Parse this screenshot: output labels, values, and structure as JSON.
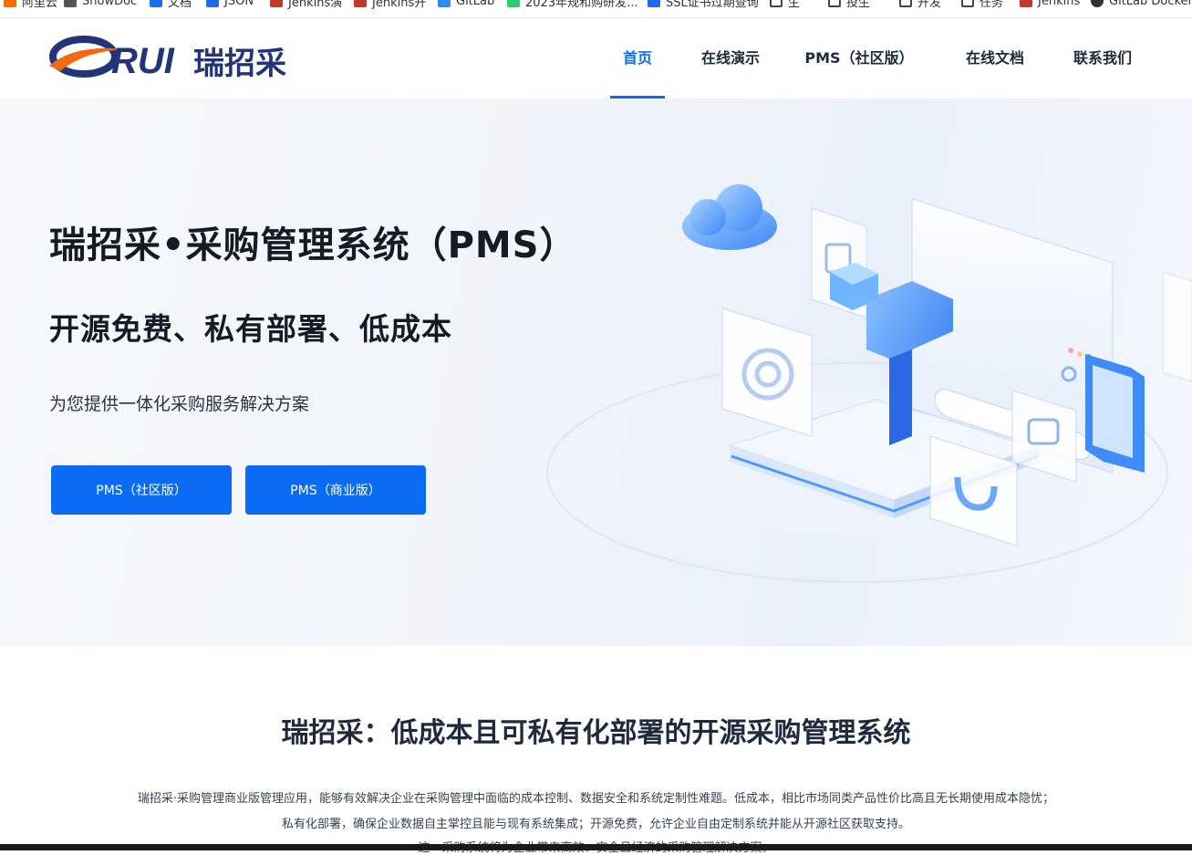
{
  "bookmarks": [
    {
      "label": "阿里云",
      "color": "#ff6a00"
    },
    {
      "label": "ShowDoc",
      "color": "#555555"
    },
    {
      "label": "文档",
      "color": "#1d6cf0"
    },
    {
      "label": "JSON",
      "color": "#1d6cf0"
    },
    {
      "label": "Jenkins演",
      "color": "#c0392b"
    },
    {
      "label": "Jenkins开",
      "color": "#c0392b"
    },
    {
      "label": "GitLab",
      "color": "#2d8cf0"
    },
    {
      "label": "2023年规和购研发...",
      "color": "#2ecc71"
    },
    {
      "label": "SSL证书过期查询",
      "color": "#1d6cf0"
    },
    {
      "label": "生",
      "color": "#555555"
    },
    {
      "label": "投生",
      "color": "#555555"
    },
    {
      "label": "开发",
      "color": "#555555"
    },
    {
      "label": "任务",
      "color": "#555555"
    },
    {
      "label": "Jenkins",
      "color": "#c0392b"
    },
    {
      "label": "GitLab Docker",
      "color": "#333333"
    }
  ],
  "header": {
    "logo_text": "RUI瑞招采",
    "nav": [
      {
        "label": "首页",
        "active": true
      },
      {
        "label": "在线演示",
        "active": false
      },
      {
        "label": "PMS（社区版）",
        "active": false
      },
      {
        "label": "在线文档",
        "active": false
      },
      {
        "label": "联系我们",
        "active": false
      }
    ]
  },
  "hero": {
    "title": "瑞招采•采购管理系统（PMS）",
    "subtitle": "开源免费、私有部署、低成本",
    "description": "为您提供一体化采购服务解决方案",
    "btn_community": "PMS（社区版）",
    "btn_commercial": "PMS（商业版）"
  },
  "intro": {
    "title": "瑞招采：低成本且可私有化部署的开源采购管理系统",
    "paragraph_1": "瑞招采·采购管理商业版管理应用，能够有效解决企业在采购管理中面临的成本控制、数据安全和系统定制性难题。低成本，相比市场同类产品性价比高且无长期使用成本隐忧；",
    "paragraph_2": "私有化部署，确保企业数据自主掌控且能与现有系统集成；开源免费，允许企业自由定制系统并能从开源社区获取支持。",
    "paragraph_3": "这一采购系统将为企业带来高效、安全且经济的采购管理解决方案。"
  },
  "colors": {
    "accent": "#0a6cf5",
    "title": "#151b26",
    "logo_navy": "#22347a",
    "logo_orange": "#f06a12"
  }
}
